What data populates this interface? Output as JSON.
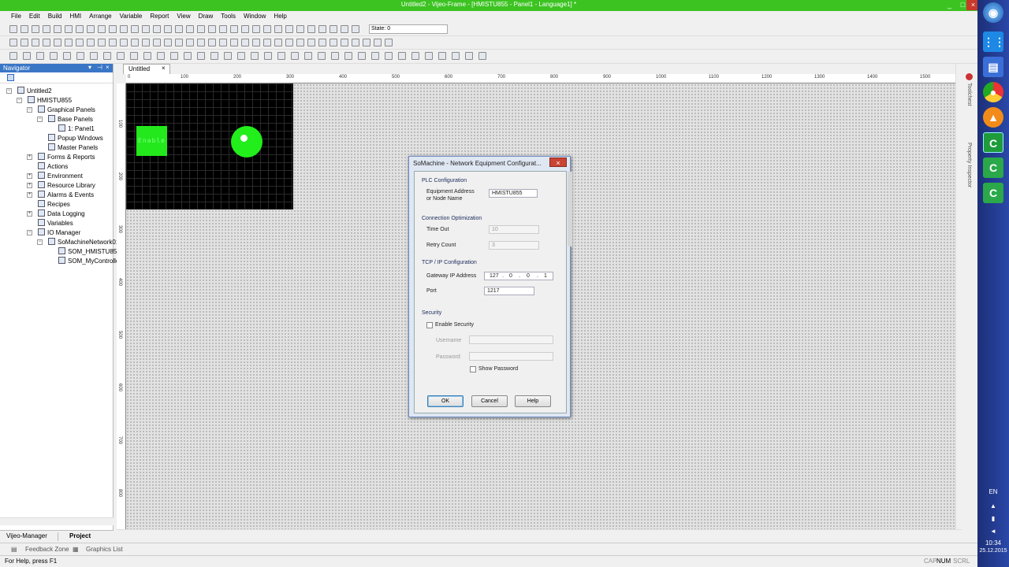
{
  "window": {
    "title": "Untitled2 - Vijeo-Frame - [HMISTU855 - Panel1 - Language1] *"
  },
  "menu": [
    "File",
    "Edit",
    "Build",
    "HMI",
    "Arrange",
    "Variable",
    "Report",
    "View",
    "Draw",
    "Tools",
    "Window",
    "Help"
  ],
  "toolbar": {
    "state_label": "State: 0"
  },
  "navigator": {
    "title": "Navigator",
    "tree": [
      {
        "label": "Untitled2",
        "level": 0
      },
      {
        "label": "HMISTU855",
        "level": 1
      },
      {
        "label": "Graphical Panels",
        "level": 2
      },
      {
        "label": "Base Panels",
        "level": 3
      },
      {
        "label": "1: Panel1",
        "level": 4
      },
      {
        "label": "Popup Windows",
        "level": 3
      },
      {
        "label": "Master Panels",
        "level": 3
      },
      {
        "label": "Forms & Reports",
        "level": 2
      },
      {
        "label": "Actions",
        "level": 2
      },
      {
        "label": "Environment",
        "level": 2
      },
      {
        "label": "Resource Library",
        "level": 2
      },
      {
        "label": "Alarms & Events",
        "level": 2
      },
      {
        "label": "Recipes",
        "level": 2
      },
      {
        "label": "Data Logging",
        "level": 2
      },
      {
        "label": "Variables",
        "level": 2
      },
      {
        "label": "IO Manager",
        "level": 2
      },
      {
        "label": "SoMachineNetwork01",
        "level": 3
      },
      {
        "label": "SOM_HMISTU855",
        "level": 4
      },
      {
        "label": "SOM_MyControlle",
        "level": 4
      }
    ],
    "tabs": [
      "Vijeo-Manager",
      "Project"
    ]
  },
  "document": {
    "tab_label": "Untitled",
    "ruler_h": [
      "0",
      "100",
      "200",
      "300",
      "400",
      "500",
      "600",
      "700",
      "800",
      "900",
      "1000",
      "1100",
      "1200",
      "1300",
      "1400",
      "1500"
    ],
    "ruler_v": [
      "100",
      "200",
      "300",
      "400",
      "500",
      "600",
      "700",
      "800"
    ],
    "panel": {
      "button_text": "Enable"
    }
  },
  "right_strip": {
    "toolchest": "Toolchest",
    "property_inspector": "Property Inspector"
  },
  "bottom_tabs": [
    "Feedback Zone",
    "Graphics List"
  ],
  "status": {
    "help": "For Help, press F1",
    "cap": "CAP",
    "num": "NUM",
    "scrl": "SCRL"
  },
  "taskbar": {
    "lang": "EN",
    "time": "10:34",
    "date": "25.12.2015"
  },
  "dialog": {
    "title": "SoMachine - Network Equipment Configurat...",
    "plc_section": "PLC Configuration",
    "equipment_label_1": "Equipment Address",
    "equipment_label_2": "or Node Name",
    "equipment_value": "HMISTU855",
    "conn_section": "Connection Optimization",
    "timeout_label": "Time Out",
    "timeout_value": "10",
    "retry_label": "Retry Count",
    "retry_value": "3",
    "tcp_section": "TCP / IP Configuration",
    "gateway_label": "Gateway IP Address",
    "ip": [
      "127",
      "0",
      "0",
      "1"
    ],
    "port_label": "Port",
    "port_value": "1217",
    "security_section": "Security",
    "enable_security": "Enable Security",
    "username_label": "Username",
    "password_label": "Password",
    "show_password": "Show Password",
    "ok": "OK",
    "cancel": "Cancel",
    "help": "Help"
  },
  "colors": {
    "titlebar": "#3cc322",
    "panel_green": "#22e81c",
    "dialog_frame": "#6d8bbf"
  }
}
